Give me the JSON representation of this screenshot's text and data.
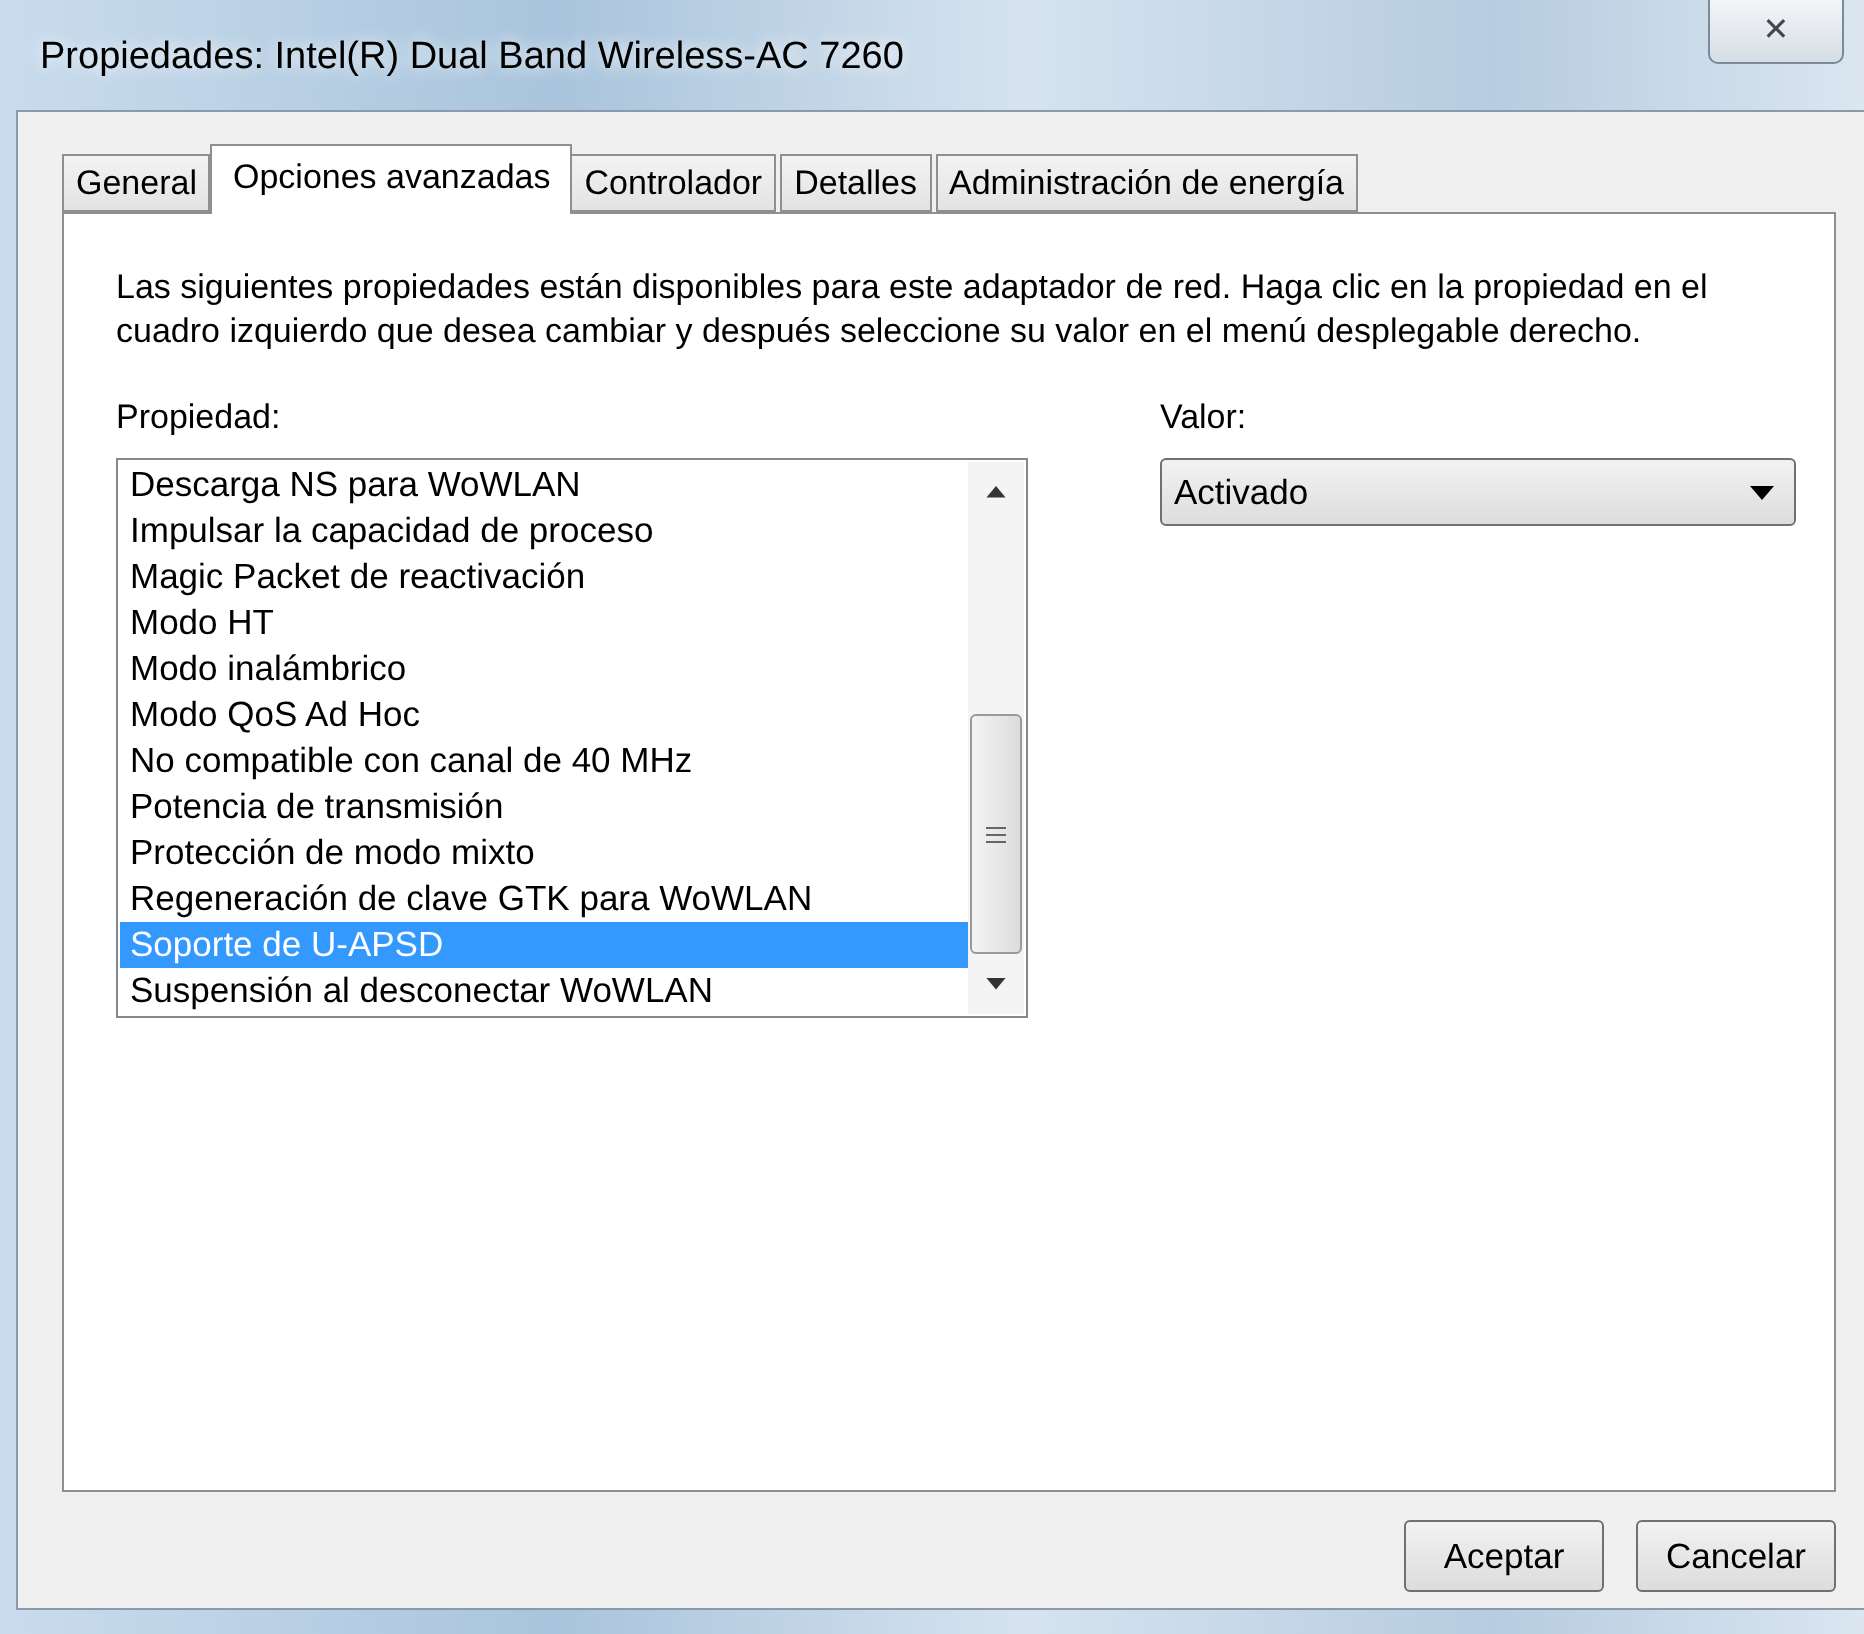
{
  "window": {
    "title": "Propiedades: Intel(R) Dual Band Wireless-AC 7260",
    "close_button": "✕"
  },
  "tabs": [
    {
      "label": "General",
      "selected": false
    },
    {
      "label": "Opciones avanzadas",
      "selected": true
    },
    {
      "label": "Controlador",
      "selected": false
    },
    {
      "label": "Detalles",
      "selected": false
    },
    {
      "label": "Administración de energía",
      "selected": false
    }
  ],
  "description": "Las siguientes propiedades están disponibles para este adaptador de red. Haga clic en la propiedad en el cuadro izquierdo que desea cambiar y después seleccione su valor en el menú desplegable derecho.",
  "property_label": "Propiedad:",
  "properties": [
    {
      "label": "Descarga NS para WoWLAN",
      "selected": false
    },
    {
      "label": "Impulsar la capacidad de proceso",
      "selected": false
    },
    {
      "label": "Magic Packet de reactivación",
      "selected": false
    },
    {
      "label": "Modo HT",
      "selected": false
    },
    {
      "label": "Modo inalámbrico",
      "selected": false
    },
    {
      "label": "Modo QoS Ad Hoc",
      "selected": false
    },
    {
      "label": "No compatible con canal de 40 MHz",
      "selected": false
    },
    {
      "label": "Potencia de transmisión",
      "selected": false
    },
    {
      "label": "Protección de modo mixto",
      "selected": false
    },
    {
      "label": "Regeneración de clave GTK para WoWLAN",
      "selected": false
    },
    {
      "label": "Soporte de U-APSD",
      "selected": true
    },
    {
      "label": "Suspensión al desconectar WoWLAN",
      "selected": false
    }
  ],
  "value_label": "Valor:",
  "value": "Activado",
  "buttons": [
    "Aceptar",
    "Cancelar"
  ]
}
